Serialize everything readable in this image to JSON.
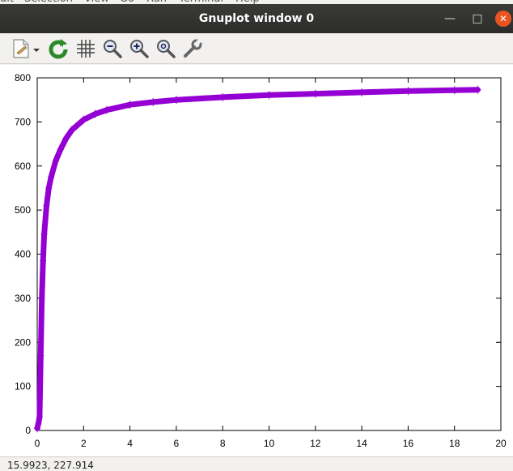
{
  "menu_peek": {
    "items": [
      "dit",
      "Selection",
      "View",
      "Go",
      "Run",
      "Terminal",
      "Help"
    ]
  },
  "window": {
    "title": "Gnuplot window 0",
    "minimize_icon": "minimize-icon",
    "maximize_icon": "maximize-icon",
    "close_icon": "close-icon"
  },
  "toolbar": {
    "icons": [
      "export-icon",
      "dropdown-arrow-icon",
      "replot-icon",
      "grid-icon",
      "zoom-out-icon",
      "zoom-in-icon",
      "unzoom-icon",
      "settings-wrench-icon"
    ]
  },
  "status": {
    "coordinates": "15.9923, 227.914"
  },
  "chart_data": {
    "type": "line",
    "title": "",
    "xlabel": "",
    "ylabel": "",
    "xlim": [
      0,
      20
    ],
    "ylim": [
      0,
      800
    ],
    "xticks": [
      "0",
      "2",
      "4",
      "6",
      "8",
      "10",
      "12",
      "14",
      "16",
      "18",
      "20"
    ],
    "yticks": [
      "0",
      "100",
      "200",
      "300",
      "400",
      "500",
      "600",
      "700",
      "800"
    ],
    "grid": false,
    "legend": "none",
    "series": [
      {
        "color": "#9400d3",
        "style": "thick line with error-bar points",
        "x": [
          0.0,
          0.05,
          0.1,
          0.15,
          0.2,
          0.25,
          0.3,
          0.4,
          0.5,
          0.6,
          0.8,
          1.0,
          1.25,
          1.5,
          2.0,
          2.5,
          3.0,
          4.0,
          5.0,
          6.0,
          8.0,
          10.0,
          12.0,
          14.0,
          16.0,
          18.0,
          19.0
        ],
        "y": [
          5,
          15,
          30,
          170,
          300,
          385,
          445,
          510,
          550,
          575,
          612,
          637,
          663,
          682,
          705,
          718,
          727,
          739,
          745,
          750,
          756,
          761,
          764,
          767,
          770,
          772,
          773
        ]
      }
    ]
  }
}
